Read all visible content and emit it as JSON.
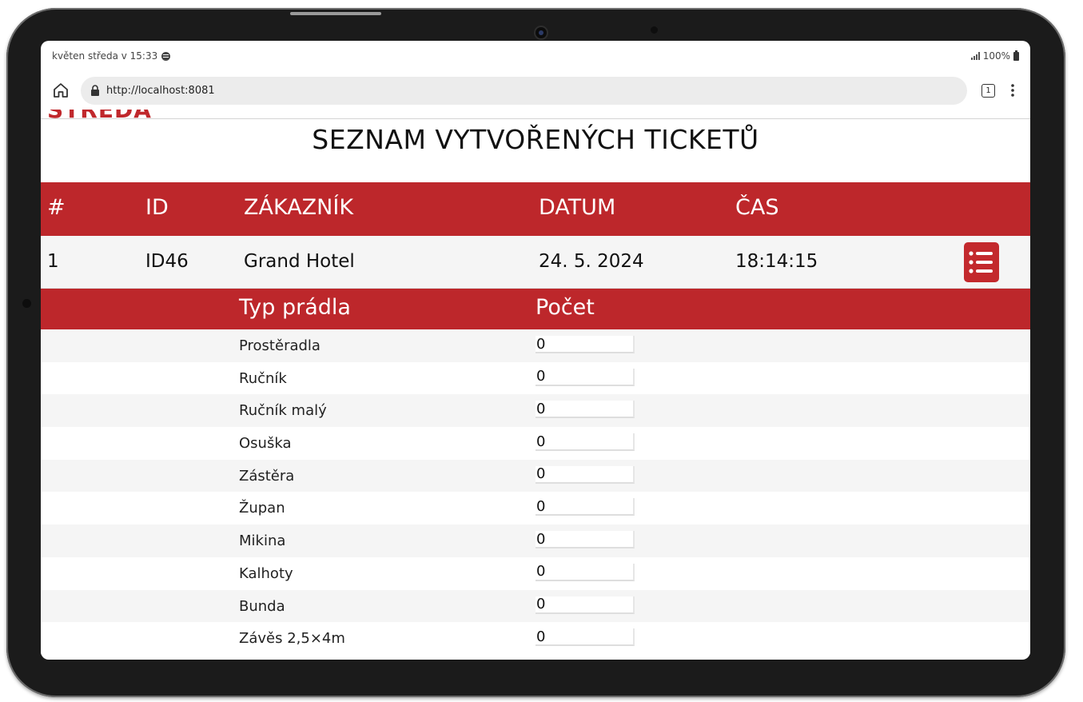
{
  "status_bar": {
    "time_text": "květen středa v 15:33",
    "battery_text": "100%"
  },
  "browser": {
    "url": "http://localhost:8081",
    "tab_count": "1"
  },
  "page": {
    "previous_heading": "STŘEDA",
    "title": "SEZNAM VYTVOŘENÝCH TICKETŮ",
    "accent_color": "#bd272b",
    "table": {
      "headers": {
        "index": "#",
        "id": "ID",
        "customer": "ZÁKAZNÍK",
        "date": "DATUM",
        "time": "ČAS"
      },
      "rows": [
        {
          "index": "1",
          "id": "ID46",
          "customer": "Grand Hotel",
          "date": "24. 5. 2024",
          "time": "18:14:15",
          "action_icon": "list-icon"
        }
      ]
    },
    "detail": {
      "headers": {
        "type": "Typ prádla",
        "count": "Počet"
      },
      "items": [
        {
          "label": "Prostěradla",
          "value": "0"
        },
        {
          "label": "Ručník",
          "value": "0"
        },
        {
          "label": "Ručník malý",
          "value": "0"
        },
        {
          "label": "Osuška",
          "value": "0"
        },
        {
          "label": "Zástěra",
          "value": "0"
        },
        {
          "label": "Župan",
          "value": "0"
        },
        {
          "label": "Mikina",
          "value": "0"
        },
        {
          "label": "Kalhoty",
          "value": "0"
        },
        {
          "label": "Bunda",
          "value": "0"
        },
        {
          "label": "Závěs 2,5×4m",
          "value": "0"
        }
      ]
    }
  }
}
